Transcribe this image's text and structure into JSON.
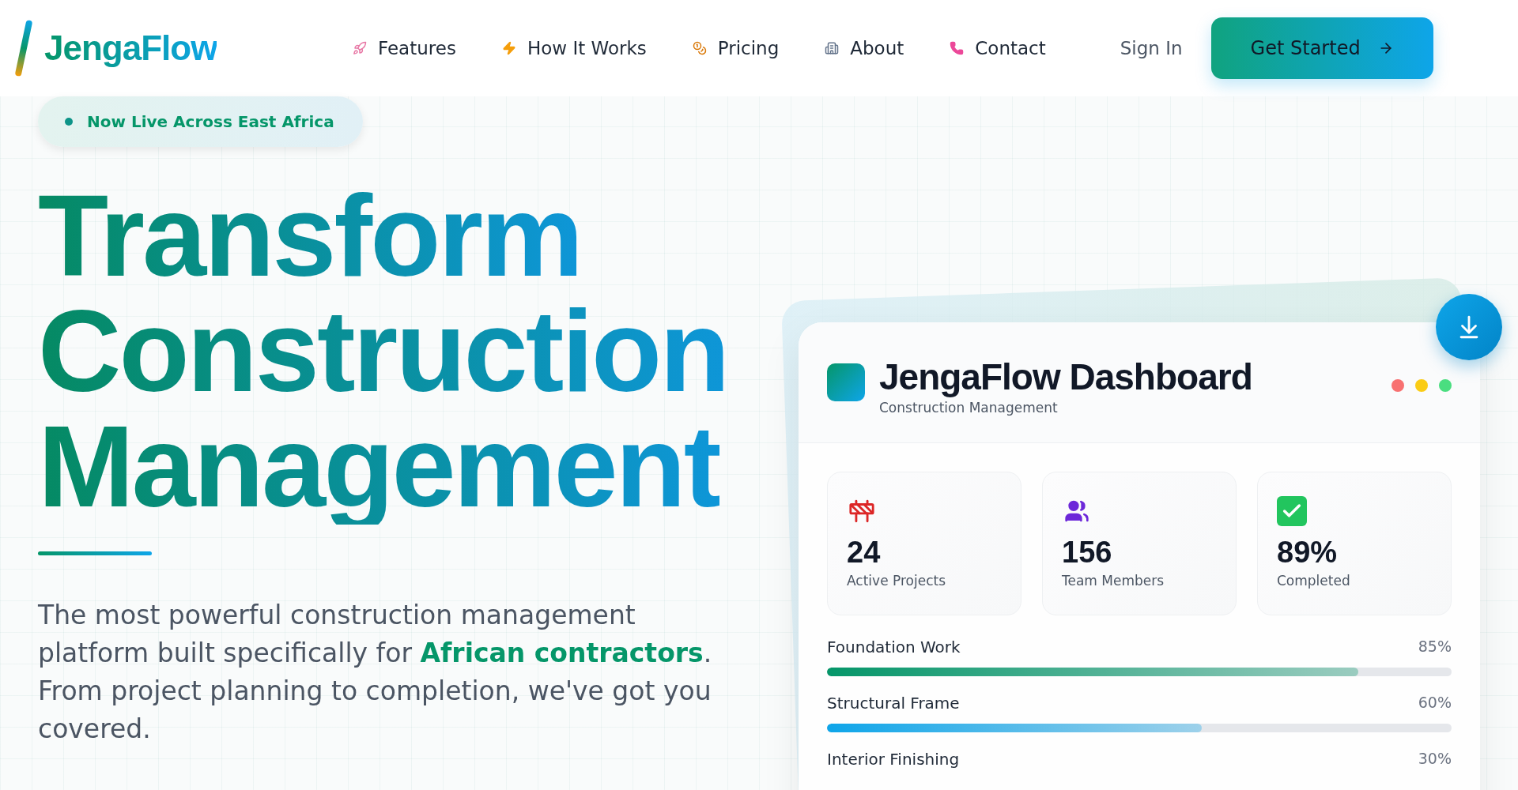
{
  "brand": {
    "name": "JengaFlow"
  },
  "nav": {
    "items": [
      {
        "label": "Features"
      },
      {
        "label": "How It Works"
      },
      {
        "label": "Pricing"
      },
      {
        "label": "About"
      },
      {
        "label": "Contact"
      }
    ],
    "sign_in": "Sign In",
    "cta": "Get Started"
  },
  "hero": {
    "badge": "Now Live Across East Africa",
    "heading": [
      "Transform",
      "Construction",
      "Management"
    ],
    "description": "The most powerful construction management platform built specifically for **African contractors**. From project planning to completion, we've got you covered."
  },
  "dashboard": {
    "title": "JengaFlow Dashboard",
    "subtitle": "Construction Management",
    "window_dots": [
      {
        "color": "#f87171"
      },
      {
        "color": "#facc15"
      },
      {
        "color": "#4ade80"
      }
    ],
    "stats": [
      {
        "value": "24",
        "label": "Active Projects"
      },
      {
        "value": "156",
        "label": "Team Members"
      },
      {
        "value": "89%",
        "label": "Completed"
      }
    ],
    "progress": [
      {
        "label": "Foundation Work",
        "reading": "85%",
        "level": 0.85,
        "color": "#059669"
      },
      {
        "label": "Structural Frame",
        "reading": "60%",
        "level": 0.6,
        "color": "#0ea5e9"
      },
      {
        "label": "Interior Finishing",
        "reading": "30%"
      }
    ]
  }
}
